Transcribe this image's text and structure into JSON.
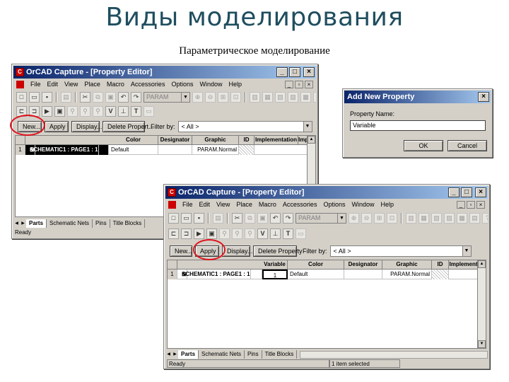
{
  "slide": {
    "title": "Виды моделирования",
    "subtitle": "Параметрическое моделирование"
  },
  "window_back": {
    "title": "OrCAD Capture - [Property Editor]",
    "menu": [
      "File",
      "Edit",
      "View",
      "Place",
      "Macro",
      "Accessories",
      "Options",
      "Window",
      "Help"
    ],
    "toolbar_combo": "PARAM",
    "toolbar_letters": [
      "V",
      "T"
    ],
    "buttons": {
      "new": "New...",
      "apply": "Apply",
      "display": "Display...",
      "delete": "Delete Propert...",
      "filter_label": "Filter by:"
    },
    "filter_value": "< All >",
    "columns": [
      "Color",
      "Designator",
      "Graphic",
      "ID",
      "Implementation",
      "Imp"
    ],
    "row": {
      "num": "1",
      "name": "SCHEMATIC1 : PAGE1 : 1",
      "color": "Default",
      "graphic": "PARAM.Normal"
    },
    "tabs": [
      "Parts",
      "Schematic Nets",
      "Pins",
      "Title Blocks"
    ],
    "status": "Ready"
  },
  "dialog": {
    "title": "Add New Property",
    "label": "Property Name:",
    "value": "Variable",
    "ok": "OK",
    "cancel": "Cancel"
  },
  "window_front": {
    "title": "OrCAD Capture - [Property Editor]",
    "menu": [
      "File",
      "Edit",
      "View",
      "Place",
      "Macro",
      "Accessories",
      "Options",
      "Window",
      "Help"
    ],
    "toolbar_combo": "PARAM",
    "toolbar_letters": [
      "V",
      "T"
    ],
    "buttons": {
      "new": "New...",
      "apply": "Apply",
      "display": "Display...",
      "delete": "Delete Property",
      "filter_label": "Filter by:"
    },
    "filter_value": "< All >",
    "columns": [
      "Variable",
      "Color",
      "Designator",
      "Graphic",
      "ID",
      "Implement"
    ],
    "row": {
      "num": "1",
      "name": "SCHEMATIC1 : PAGE1 : 1",
      "variable": "1",
      "color": "Default",
      "graphic": "PARAM.Normal"
    },
    "tabs": [
      "Parts",
      "Schematic Nets",
      "Pins",
      "Title Blocks"
    ],
    "status": "Ready",
    "status_right": "1 item selected"
  },
  "colors": {
    "title_text": "#1f4e5f",
    "highlight_ring": "#e0141e",
    "titlebar": "#0a246a"
  }
}
